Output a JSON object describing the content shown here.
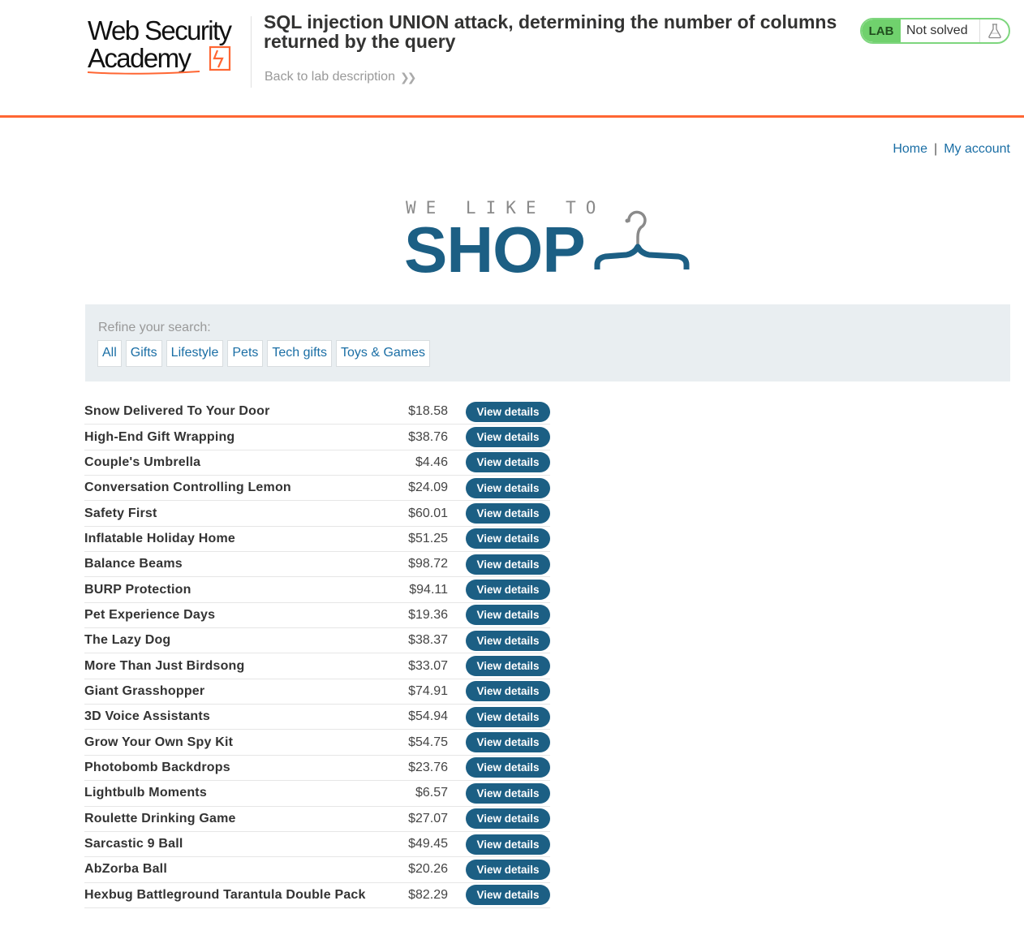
{
  "academy": {
    "logo_line1": "Web Security",
    "logo_line2": "Academy",
    "lab_title": "SQL injection UNION attack, determining the number of columns returned by the query",
    "back_link": "Back to lab description",
    "lab_tag": "LAB",
    "lab_status": "Not solved",
    "accent_color": "#ff6633"
  },
  "nav": {
    "home": "Home",
    "separator": "|",
    "my_account": "My account"
  },
  "shop_logo": {
    "tagline": "WE LIKE TO",
    "word": "SHOP"
  },
  "filter": {
    "label": "Refine your search:",
    "categories": [
      "All",
      "Gifts",
      "Lifestyle",
      "Pets",
      "Tech gifts",
      "Toys & Games"
    ]
  },
  "products": [
    {
      "name": "Snow Delivered To Your Door",
      "price": "$18.58",
      "button": "View details"
    },
    {
      "name": "High-End Gift Wrapping",
      "price": "$38.76",
      "button": "View details"
    },
    {
      "name": "Couple's Umbrella",
      "price": "$4.46",
      "button": "View details"
    },
    {
      "name": "Conversation Controlling Lemon",
      "price": "$24.09",
      "button": "View details"
    },
    {
      "name": "Safety First",
      "price": "$60.01",
      "button": "View details"
    },
    {
      "name": "Inflatable Holiday Home",
      "price": "$51.25",
      "button": "View details"
    },
    {
      "name": "Balance Beams",
      "price": "$98.72",
      "button": "View details"
    },
    {
      "name": "BURP Protection",
      "price": "$94.11",
      "button": "View details"
    },
    {
      "name": "Pet Experience Days",
      "price": "$19.36",
      "button": "View details"
    },
    {
      "name": "The Lazy Dog",
      "price": "$38.37",
      "button": "View details"
    },
    {
      "name": "More Than Just Birdsong",
      "price": "$33.07",
      "button": "View details"
    },
    {
      "name": "Giant Grasshopper",
      "price": "$74.91",
      "button": "View details"
    },
    {
      "name": "3D Voice Assistants",
      "price": "$54.94",
      "button": "View details"
    },
    {
      "name": "Grow Your Own Spy Kit",
      "price": "$54.75",
      "button": "View details"
    },
    {
      "name": "Photobomb Backdrops",
      "price": "$23.76",
      "button": "View details"
    },
    {
      "name": "Lightbulb Moments",
      "price": "$6.57",
      "button": "View details"
    },
    {
      "name": "Roulette Drinking Game",
      "price": "$27.07",
      "button": "View details"
    },
    {
      "name": "Sarcastic 9 Ball",
      "price": "$49.45",
      "button": "View details"
    },
    {
      "name": "AbZorba Ball",
      "price": "$20.26",
      "button": "View details"
    },
    {
      "name": "Hexbug Battleground Tarantula Double Pack",
      "price": "$82.29",
      "button": "View details"
    }
  ],
  "icons": {
    "flask": "flask-icon",
    "chevron": "double-chevron-right-icon",
    "hanger": "hanger-icon"
  },
  "colors": {
    "brand_blue": "#1c5f84",
    "link_blue": "#1a6ea5",
    "lab_green": "#70d16d"
  }
}
